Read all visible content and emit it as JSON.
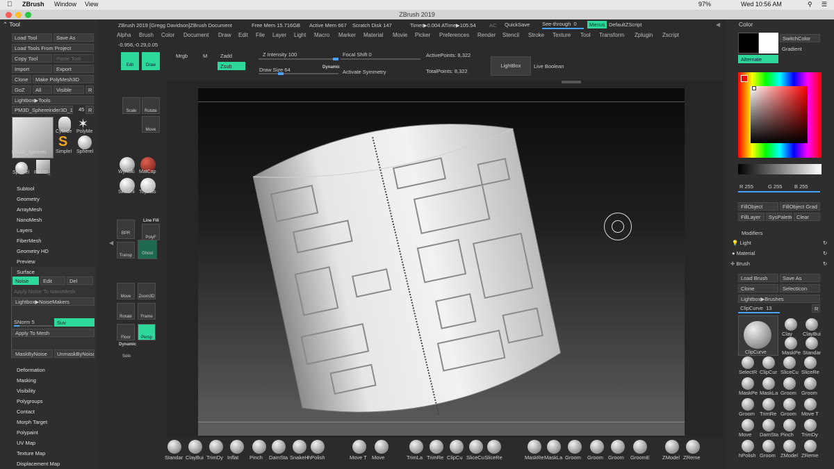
{
  "menubar": {
    "app": "ZBrush",
    "items": [
      "Window",
      "View"
    ],
    "battery": "97%",
    "clock": "Wed 10:56 AM"
  },
  "window": {
    "title": "ZBrush 2019"
  },
  "status": {
    "doc": "ZBrush 2019 [Gregg Davidson]ZBrush Document",
    "free_mem": "Free Mem 15.716GB",
    "active_mem": "Active Mem 667",
    "scratch": "Scratch Disk 147",
    "timer": "Timer▶0.004 ATime▶105.54",
    "ac": "AC",
    "quicksave": "QuickSave",
    "see_through": "See-through",
    "see_through_value": "0",
    "menus": "Menus",
    "default_zscript": "DefaultZScript"
  },
  "mainmenu": [
    "Alpha",
    "Brush",
    "Color",
    "Document",
    "Draw",
    "Edit",
    "File",
    "Layer",
    "Light",
    "Macro",
    "Marker",
    "Material",
    "Movie",
    "Picker",
    "Preferences",
    "Render",
    "Stencil",
    "Stroke",
    "Texture",
    "Tool",
    "Transform",
    "Zplugin",
    "Zscript"
  ],
  "coords": "-0.956,-0.29,0.05",
  "tooltop": {
    "edit": "Edit",
    "draw": "Draw",
    "mrgb": "Mrgb",
    "m": "M",
    "zadd": "Zadd",
    "zsub": "Zsub",
    "z_intensity": "Z Intensity",
    "z_intensity_val": "100",
    "draw_size": "Draw Size",
    "draw_size_val": "64",
    "dynamic": "Dynamic",
    "focal_shift": "Focal Shift",
    "focal_shift_val": "0",
    "activate_symmetry": "Activate Symmetry",
    "active_points": "ActivePoints: 8,322",
    "total_points": "TotalPoints: 8,322",
    "lightbox": "LightBox",
    "live_boolean": "Live Boolean"
  },
  "leftpanel": {
    "header": "Tool",
    "load_tool": "Load Tool",
    "save_as": "Save As",
    "load_from_project": "Load Tools From Project",
    "copy_tool": "Copy Tool",
    "paste_tool": "Paste Tool",
    "import": "Import",
    "export": "Export",
    "clone": "Clone",
    "make_polymesh": "Make PolyMesh3D",
    "goz": "GoZ",
    "all": "All",
    "visible": "Visible",
    "r": "R",
    "lightbox_tools": "Lightbox▶Tools",
    "tool_name": "PM3D_Sphereinder3D_1.",
    "tool_num": "45",
    "r2": "R",
    "thumbs": [
      "PM3D_Sphereir",
      "Cylinde",
      "PolyMe",
      "SimpleI",
      "Spherel",
      "Spherel",
      "PM3D_"
    ],
    "subpalettes": [
      "Subtool",
      "Geometry",
      "ArrayMesh",
      "NanoMesh",
      "Layers",
      "FiberMesh",
      "Geometry HD",
      "Preview",
      "Surface"
    ],
    "noise": "Noise",
    "edit": "Edit",
    "del": "Del",
    "apply_noise_nanomesh": "Apply Noise To NanoMesh",
    "lightbox_noise": "Lightbox▶NoiseMakers",
    "snorm": "SNorm",
    "snorm_val": "5",
    "suv": "Suv",
    "apply_to_mesh": "Apply To Mesh",
    "mask_by_noise": "MaskByNoise",
    "unmask_by_noise": "UnmaskByNoise",
    "lower": [
      "Deformation",
      "Masking",
      "Visibility",
      "Polygroups",
      "Contact",
      "Morph Target",
      "Polypaint",
      "UV Map",
      "Texture Map",
      "Displacement Map"
    ]
  },
  "shelf": {
    "scale": "Scale",
    "rotate": "Rotate",
    "move": "Move",
    "wynski": "WynSki",
    "matcap": "MatCap",
    "skinsh": "SkinShi",
    "toyplas": "ToyPlas",
    "bpr": "BPR",
    "linefill": "Line Fill",
    "polyf": "PolyF",
    "transp": "Transp",
    "ghost": "Ghost",
    "move2": "Move",
    "zoom3d": "Zoom3D",
    "rotate2": "Rotate",
    "frame": "Frame",
    "floor": "Floor",
    "persp": "Persp",
    "dynamic": "Dynamic",
    "solo": "Solo"
  },
  "bottom": [
    "Standar",
    "ClayBui",
    "TrimDy",
    "Inflat",
    "Pinch",
    "DamSta",
    "SnakeH",
    "hPolish",
    "Move T",
    "Move",
    "TrimLa",
    "TrimRe",
    "ClipCu",
    "SliceCu",
    "SliceRe",
    "MaskRe",
    "MaskLa",
    "Groom",
    "Groom",
    "Groom",
    "GroomE",
    "ZModel",
    "ZReme"
  ],
  "rightpanel": {
    "color": "Color",
    "switch_color": "SwitchColor",
    "gradient": "Gradient",
    "alternate": "Alternate",
    "r": "R 255",
    "g": "G 255",
    "b": "B 255",
    "fill_object": "FillObject",
    "fill_object_grad": "FillObject Grad",
    "fill_layer": "FillLayer",
    "sys_palette": "SysPalette",
    "clear": "Clear",
    "modifiers": "Modifiers",
    "light": "Light",
    "material": "Material",
    "brush": "Brush",
    "load_brush": "Load Brush",
    "save_as": "Save As",
    "clone": "Clone",
    "select_icon": "SelectIcon",
    "lightbox_brushes": "Lightbox▶Brushes",
    "clipcurve": "ClipCurve",
    "clipcurve_val": "13",
    "r2": "R",
    "big_brush": "ClipCurve",
    "brush_labels": [
      "Clay",
      "ClayBui",
      "MaskPe",
      "Standar",
      "SelectR",
      "ClipCur",
      "SliceCu",
      "SliceRe",
      "MaskPe",
      "MaskLa",
      "Groom",
      "Groom",
      "Groom",
      "TrimRe",
      "Groom",
      "Move T",
      "Move",
      "DamSta",
      "Pinch",
      "TrimDy",
      "hPolish",
      "Groom",
      "ZModel",
      "ZReme"
    ]
  },
  "colors": {
    "accent": "#2ed89b",
    "bg": "#2b2b2b",
    "panel": "#2e2e2e"
  }
}
